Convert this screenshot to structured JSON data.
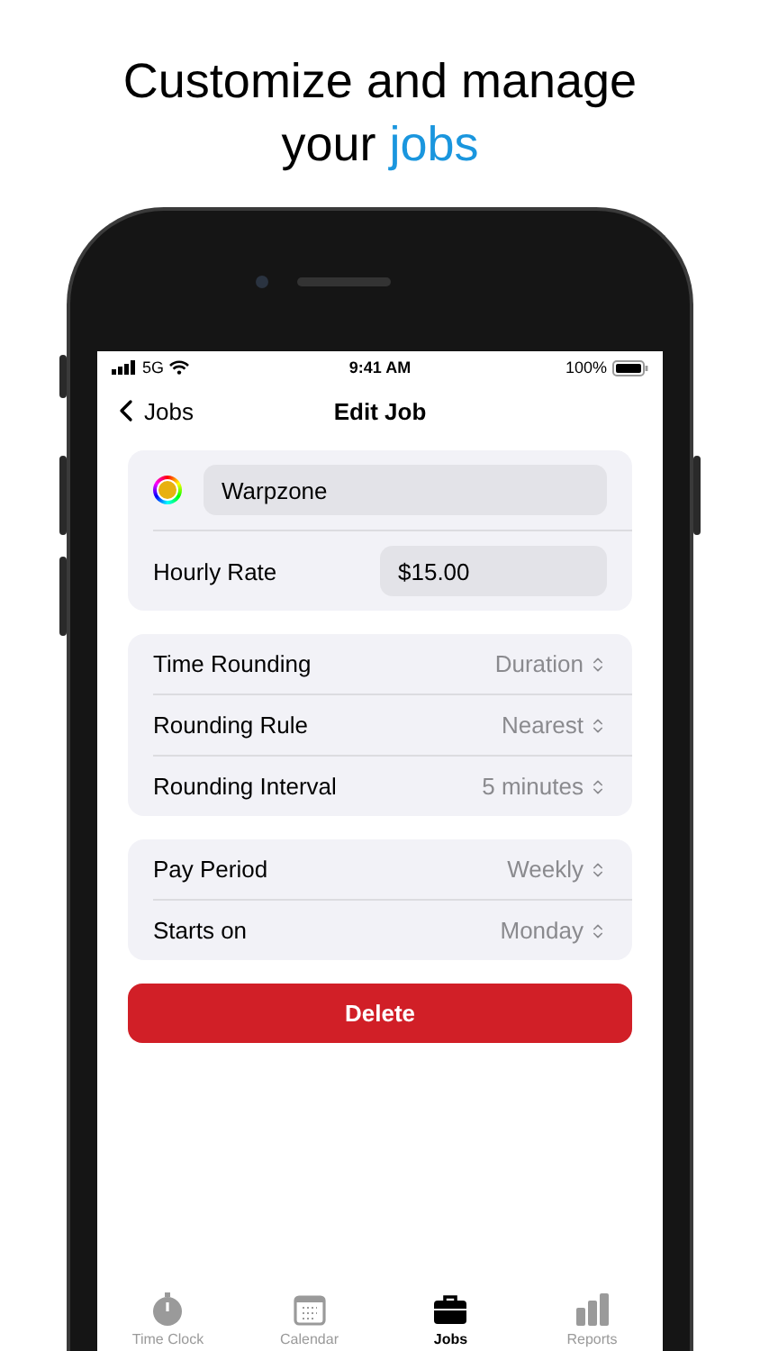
{
  "headline": {
    "text": "Customize and manage your",
    "highlight": "jobs"
  },
  "status_bar": {
    "carrier": "5G",
    "time": "9:41 AM",
    "battery": "100%"
  },
  "nav": {
    "back": "Jobs",
    "title": "Edit Job"
  },
  "job": {
    "color": "#e8b010",
    "name": "Warpzone",
    "rate_label": "Hourly Rate",
    "rate": "$15.00"
  },
  "sections": [
    [
      {
        "label": "Time Rounding",
        "value": "Duration"
      },
      {
        "label": "Rounding Rule",
        "value": "Nearest"
      },
      {
        "label": "Rounding Interval",
        "value": "5 minutes"
      }
    ],
    [
      {
        "label": "Pay Period",
        "value": "Weekly"
      },
      {
        "label": "Starts on",
        "value": "Monday"
      }
    ]
  ],
  "delete_button": "Delete",
  "tabs": [
    {
      "kind": "timer",
      "label": "Time Clock",
      "selected": false
    },
    {
      "kind": "calendar",
      "label": "Calendar",
      "selected": false
    },
    {
      "kind": "briefcase",
      "label": "Jobs",
      "selected": true
    },
    {
      "kind": "chart",
      "label": "Reports",
      "selected": false
    }
  ]
}
